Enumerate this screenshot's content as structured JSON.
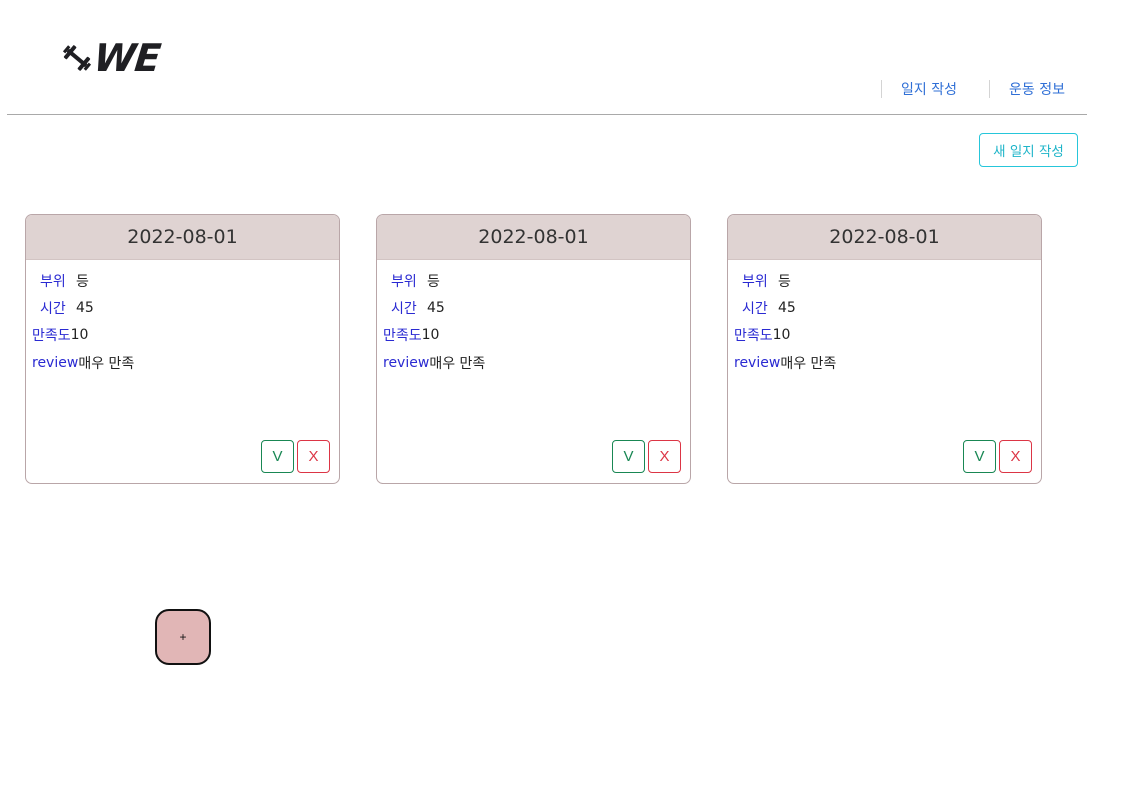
{
  "header": {
    "logo_text": "WE",
    "nav": {
      "write_log": "일지 작성",
      "exercise_info": "운동 정보"
    }
  },
  "toolbar": {
    "new_log": "새 일지 작성"
  },
  "labels": {
    "part": "부위",
    "time": "시간",
    "satisfaction": "만족도",
    "review": "review"
  },
  "cards": [
    {
      "date": "2022-08-01",
      "part": "등",
      "time": "45",
      "satisfaction": "10",
      "review": "매우 만족",
      "confirm": "V",
      "delete": "X"
    },
    {
      "date": "2022-08-01",
      "part": "등",
      "time": "45",
      "satisfaction": "10",
      "review": "매우 만족",
      "confirm": "V",
      "delete": "X"
    },
    {
      "date": "2022-08-01",
      "part": "등",
      "time": "45",
      "satisfaction": "10",
      "review": "매우 만족",
      "confirm": "V",
      "delete": "X"
    }
  ],
  "fab": {
    "label": "+"
  },
  "colors": {
    "accent": "#26c6da",
    "card_header": "#dfd3d2",
    "confirm": "#198754",
    "delete": "#dc3545",
    "fab": "#e1b6b6",
    "nav_link": "#2f6fd6"
  }
}
